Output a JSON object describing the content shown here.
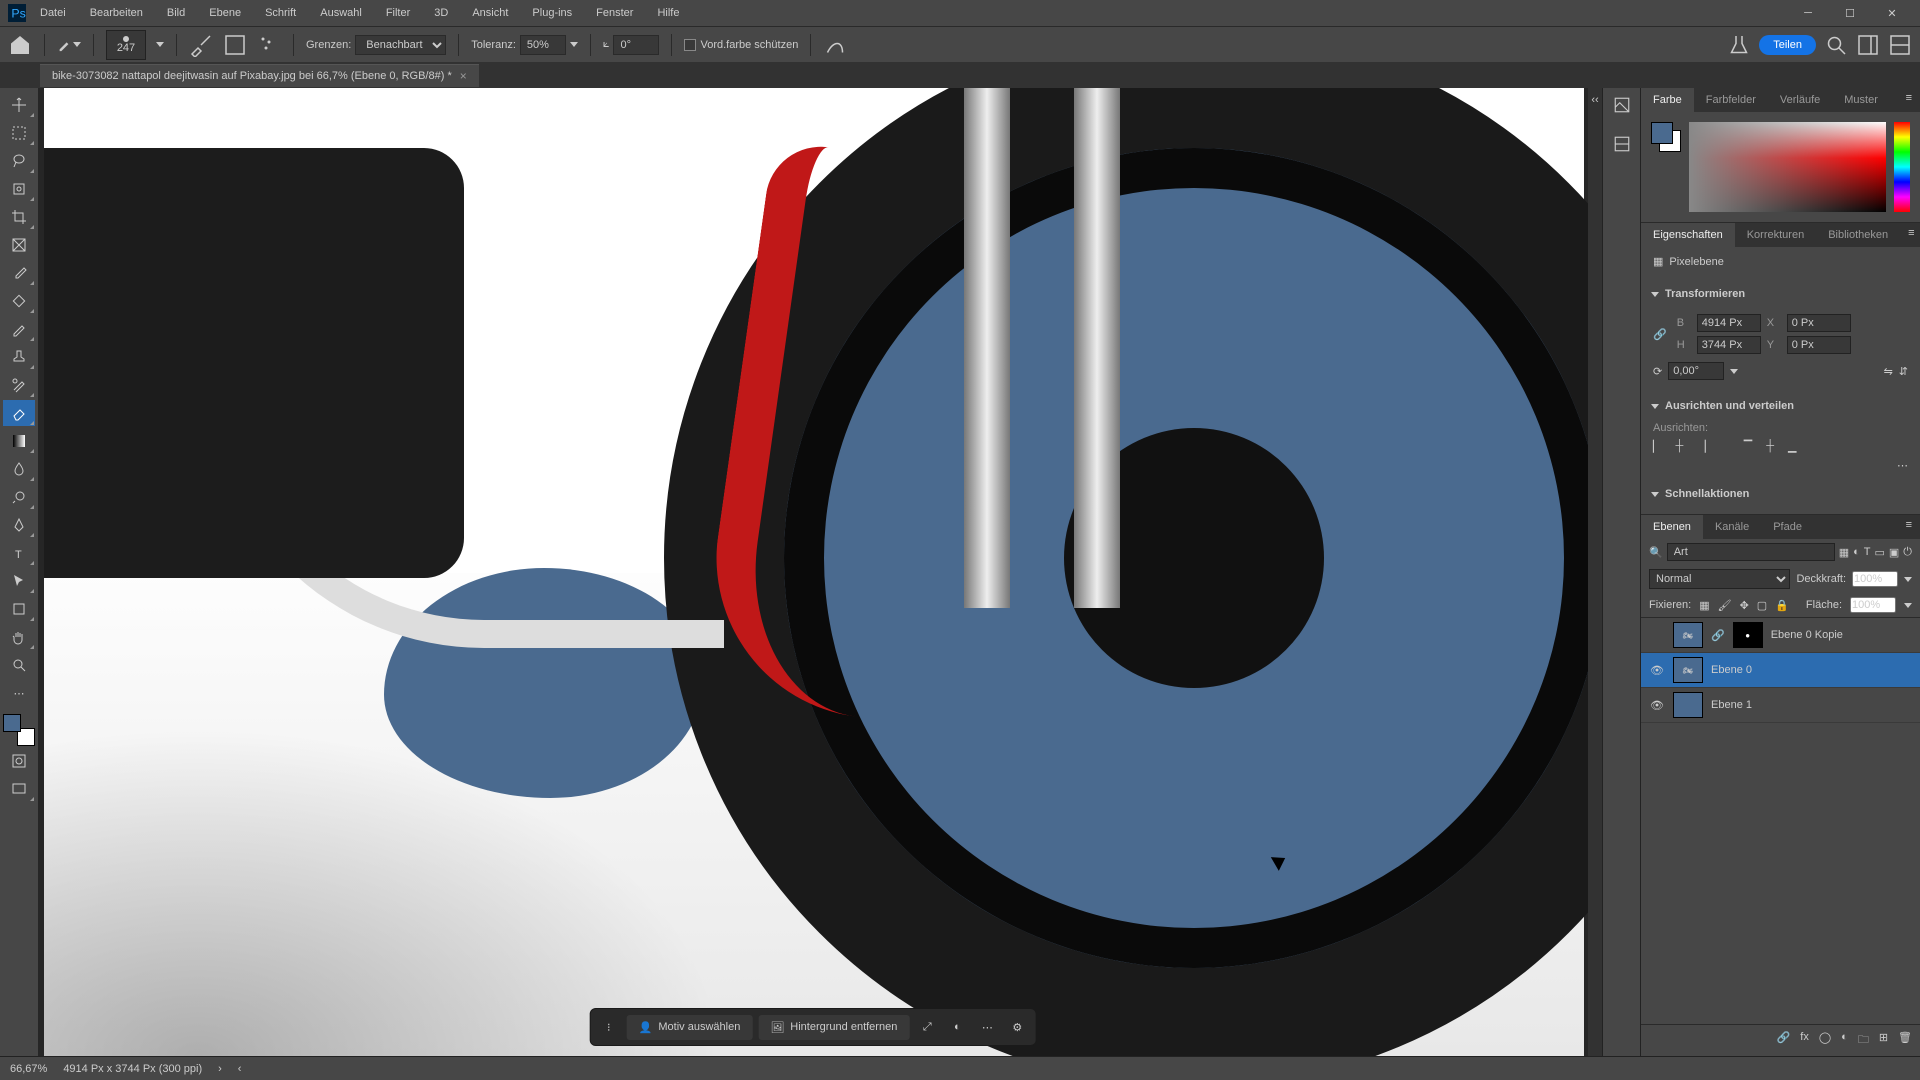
{
  "menu": {
    "items": [
      "Datei",
      "Bearbeiten",
      "Bild",
      "Ebene",
      "Schrift",
      "Auswahl",
      "Filter",
      "3D",
      "Ansicht",
      "Plug-ins",
      "Fenster",
      "Hilfe"
    ]
  },
  "options": {
    "brush_size": "247",
    "limits_label": "Grenzen:",
    "limits_value": "Benachbart",
    "tolerance_label": "Toleranz:",
    "tolerance_value": "50%",
    "angle_value": "0°",
    "protect_fg": "Vord.farbe schützen",
    "share": "Teilen"
  },
  "document": {
    "tab_title": "bike-3073082 nattapol deejitwasin auf Pixabay.jpg bei 66,7% (Ebene 0, RGB/8#) *"
  },
  "context_bar": {
    "select_subject": "Motiv auswählen",
    "remove_bg": "Hintergrund entfernen"
  },
  "color_tabs": [
    "Farbe",
    "Farbfelder",
    "Verläufe",
    "Muster"
  ],
  "props_tabs": [
    "Eigenschaften",
    "Korrekturen",
    "Bibliotheken"
  ],
  "properties": {
    "type": "Pixelebene",
    "transform_header": "Transformieren",
    "w_label": "B",
    "w_value": "4914 Px",
    "x_label": "X",
    "x_value": "0 Px",
    "h_label": "H",
    "h_value": "3744 Px",
    "y_label": "Y",
    "y_value": "0 Px",
    "angle": "0,00°",
    "align_header": "Ausrichten und verteilen",
    "align_label": "Ausrichten:",
    "quick_header": "Schnellaktionen"
  },
  "layers_tabs": [
    "Ebenen",
    "Kanäle",
    "Pfade"
  ],
  "layers": {
    "search_kind": "Art",
    "blend": "Normal",
    "opacity_label": "Deckkraft:",
    "opacity": "100%",
    "lock_label": "Fixieren:",
    "fill_label": "Fläche:",
    "fill": "100%",
    "items": [
      {
        "name": "Ebene 0 Kopie",
        "visible": false,
        "mask": true
      },
      {
        "name": "Ebene 0",
        "visible": true,
        "selected": true
      },
      {
        "name": "Ebene 1",
        "visible": true,
        "solid": true
      }
    ]
  },
  "status": {
    "zoom": "66,67%",
    "dims": "4914 Px x 3744 Px (300 ppi)"
  }
}
